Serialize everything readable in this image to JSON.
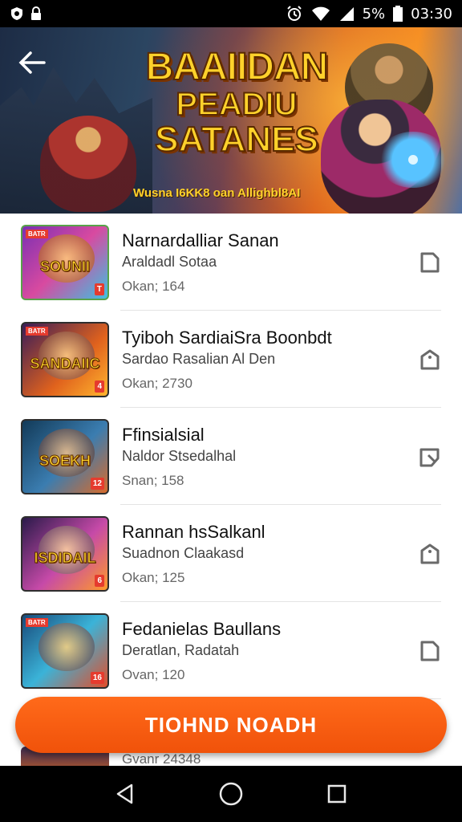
{
  "status_bar": {
    "battery": "5%",
    "time": "03:30",
    "icons": [
      "shield-icon",
      "lock-icon",
      "alarm-icon",
      "wifi-icon",
      "signal-icon",
      "battery-icon"
    ]
  },
  "banner": {
    "title_line1": "BAAIIDAN",
    "title_line2": "PEADIU",
    "title_line3": "SATANES",
    "subtitle": "Wusna I6KK8 oan Allighbl8AI"
  },
  "items": [
    {
      "title": "Narnardalliar Sanan",
      "subtitle": "Araldadl Sotaa",
      "meta": "Okan; 164",
      "thumb_text": "SOUNII",
      "icon": "document-icon",
      "colors": [
        "#7a2fb3",
        "#d84aa0",
        "#3ec0e0"
      ]
    },
    {
      "title": "Tyiboh SardiaiSra Boonbdt",
      "subtitle": "Sardao Rasalian Al Den",
      "meta": "Okan; 2730",
      "thumb_text": "SANDAIIC",
      "icon": "tag-icon",
      "colors": [
        "#3a1c58",
        "#e0621d",
        "#ffb52e"
      ]
    },
    {
      "title": "Ffinsialsial",
      "subtitle": "Naldor Stsedalhal",
      "meta": "Snan; 158",
      "thumb_text": "SOEKH",
      "icon": "folder-icon",
      "colors": [
        "#123a58",
        "#3b7db0",
        "#d96b2b"
      ]
    },
    {
      "title": "Rannan hsSalkanl",
      "subtitle": "Suadnon Claakasd",
      "meta": "Okan; 125",
      "thumb_text": "ISDIDAIL",
      "icon": "tag-icon",
      "colors": [
        "#2a1a4a",
        "#c64aa8",
        "#ff9a2a"
      ]
    },
    {
      "title": "Fedanielas Baullans",
      "subtitle": "Deratlan, Radatah",
      "meta": "Ovan; 120",
      "thumb_text": "",
      "icon": "document-icon",
      "colors": [
        "#184a7a",
        "#3bb3d8",
        "#e24e2a"
      ]
    }
  ],
  "peek_item": {
    "meta": "Gvanr 24348"
  },
  "cta": {
    "label": "TIOHND NOADH"
  },
  "nav": {
    "back": "back-icon",
    "home": "home-icon",
    "recents": "recents-icon"
  }
}
